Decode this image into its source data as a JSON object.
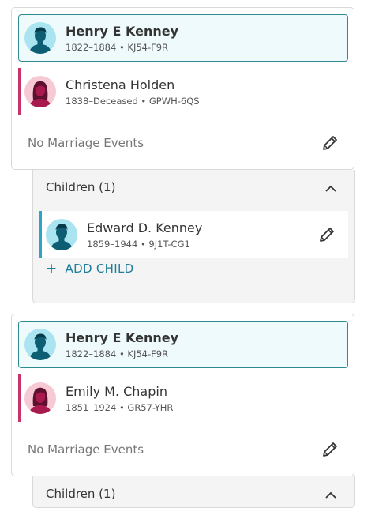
{
  "family1": {
    "husband": {
      "name": "Henry E Kenney",
      "dates": "1822–1884",
      "sep": "•",
      "id": "KJ54-F9R"
    },
    "wife": {
      "name": "Christena Holden",
      "dates": "1838–Deceased",
      "sep": "•",
      "id": "GPWH-6QS"
    },
    "no_marriage": "No Marriage Events",
    "children_title": "Children (1)",
    "children": [
      {
        "name": "Edward D. Kenney",
        "dates": "1859–1944",
        "sep": "•",
        "id": "9J1T-CG1"
      }
    ],
    "add_child": "ADD CHILD"
  },
  "family2": {
    "husband": {
      "name": "Henry E Kenney",
      "dates": "1822–1884",
      "sep": "•",
      "id": "KJ54-F9R"
    },
    "wife": {
      "name": "Emily M. Chapin",
      "dates": "1851–1924",
      "sep": "•",
      "id": "GR57-YHR"
    },
    "no_marriage": "No Marriage Events",
    "children_title": "Children (1)"
  },
  "icons": {
    "male_avatar": "male-avatar-icon",
    "female_avatar": "female-avatar-icon",
    "edit": "pencil-icon",
    "collapse": "chevron-up-icon",
    "add": "plus-icon"
  },
  "colors": {
    "primary_border": "#2e8a91",
    "spouse_bar": "#c8336a",
    "child_bar": "#2ba4c8",
    "link": "#1f7e99"
  }
}
